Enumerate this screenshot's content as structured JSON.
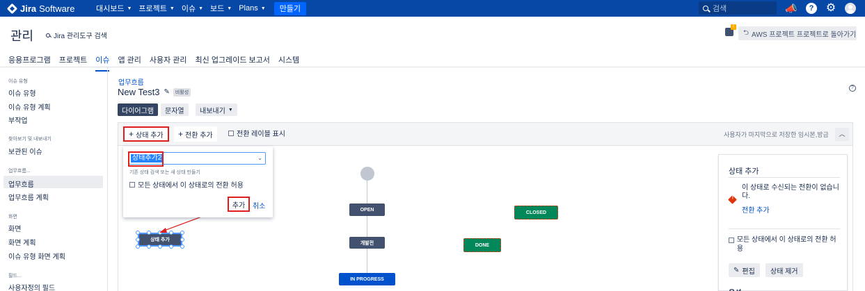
{
  "topnav": {
    "logo_prefix": "Jira",
    "logo_suffix": "Software",
    "items": [
      {
        "label": "대시보드",
        "chevron": true
      },
      {
        "label": "프로젝트",
        "chevron": true
      },
      {
        "label": "이슈",
        "chevron": true
      },
      {
        "label": "보드",
        "chevron": true
      },
      {
        "label": "Plans",
        "chevron": true
      }
    ],
    "create_label": "만들기",
    "search_placeholder": "검색"
  },
  "admin": {
    "title": "관리",
    "search_label": "Jira 관리도구 검색",
    "aws_button": "AWS 프로젝트 프로젝트로 돌아가기",
    "tabs": [
      {
        "label": "응용프로그램",
        "active": false
      },
      {
        "label": "프로젝트",
        "active": false
      },
      {
        "label": "이슈",
        "active": true
      },
      {
        "label": "앱 관리",
        "active": false
      },
      {
        "label": "사용자 관리",
        "active": false
      },
      {
        "label": "최신 업그레이드 보고서",
        "active": false
      },
      {
        "label": "시스템",
        "active": false
      }
    ]
  },
  "sidebar": {
    "group1": "이슈 유형",
    "item1": "이슈 유형",
    "item2": "이슈 유형 계획",
    "item3": "부작업",
    "group2": "찾아보기 및 내보내기",
    "item4": "보관된 이슈",
    "group3": "업무흐름...",
    "item5": "업무흐름",
    "item6": "업무흐름 계획",
    "group4": "화면",
    "item7": "화면",
    "item8": "화면 계획",
    "item9": "이슈 유형 화면 계획",
    "group5": "필드...",
    "item10": "사용자정의 필드"
  },
  "main": {
    "breadcrumb": "업무흐름",
    "title": "New Test3",
    "badge": "비활성",
    "diagram_btn": "다이어그램",
    "text_btn": "문자열",
    "export_btn": "내보내기"
  },
  "toolbar": {
    "add_status": "상태 추가",
    "add_transition": "전환 추가",
    "show_labels": "전환 레이블 표시",
    "saved_note": "사용자가 마지막으로 저장한 임시본,방금"
  },
  "popup": {
    "selected_value": "상태추가2",
    "hint": "기존 상태 검색 또는 새 상태 만들기",
    "allow_all": "모든 상태에서 이 상태로의 전환 허용",
    "add": "추가",
    "cancel": "취소"
  },
  "nodes": {
    "open": "OPEN",
    "dev": "개발전",
    "inprogress": "IN PROGRESS",
    "closed": "CLOSED",
    "done": "DONE",
    "new_status": "상태 추가"
  },
  "colors": {
    "nav": "#0747a6",
    "node_dark": "#42526e",
    "node_green": "#00875a",
    "node_blue": "#0052cc",
    "highlight_red": "#e01e1e"
  },
  "rpanel": {
    "title": "상태 추가",
    "message": "이 상태로 수신되는 전환이 없습니다.",
    "link": "전환 추가",
    "allow_all": "모든 상태에서 이 상태로의 전환 허용",
    "edit_btn": "편집",
    "remove_btn": "상태 제거",
    "cut_label": "옵션"
  }
}
